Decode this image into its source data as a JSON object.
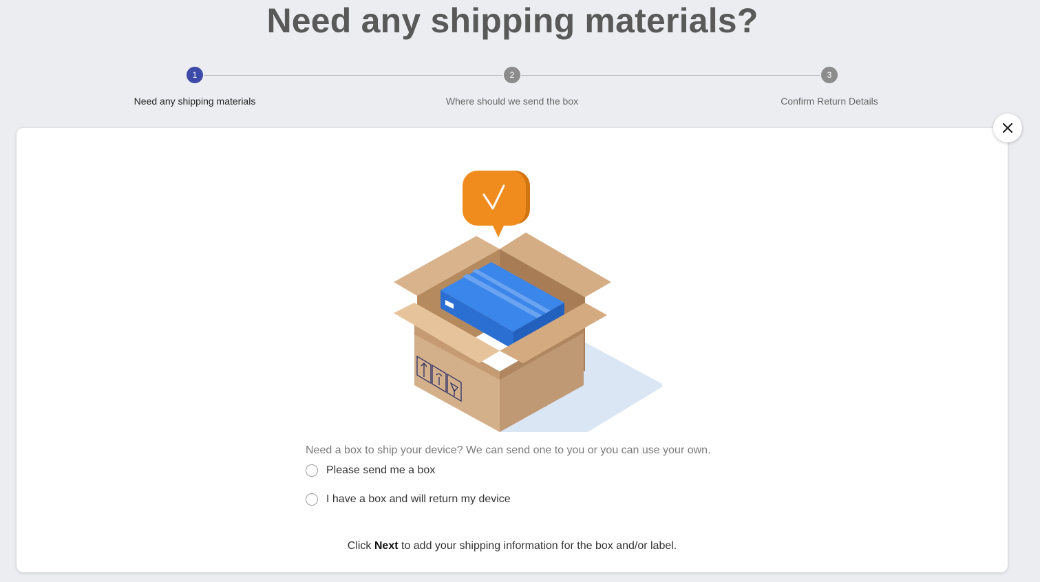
{
  "page": {
    "title": "Need any shipping materials?"
  },
  "stepper": {
    "steps": [
      {
        "number": "1",
        "label": "Need any shipping materials",
        "state": "active"
      },
      {
        "number": "2",
        "label": "Where should we send the box",
        "state": "inactive"
      },
      {
        "number": "3",
        "label": "Confirm Return Details",
        "state": "inactive"
      }
    ]
  },
  "dialog": {
    "close_icon": "close-icon",
    "illustration_icon": "open-box-with-check-icon",
    "question": "Need a box to ship your device? We can send one to you or you can use your own.",
    "options": [
      {
        "label": "Please send me a box",
        "selected": false
      },
      {
        "label": "I have a box and will return my device",
        "selected": false
      }
    ],
    "footer": {
      "prefix": "Click ",
      "bold": "Next",
      "suffix": " to add your shipping information for the box and/or label."
    }
  },
  "colors": {
    "background": "#ecedf0",
    "step_active": "#3d4aa8",
    "step_inactive": "#8c8c8c",
    "badge_orange": "#f08c1e",
    "package_blue": "#2b74d8"
  }
}
